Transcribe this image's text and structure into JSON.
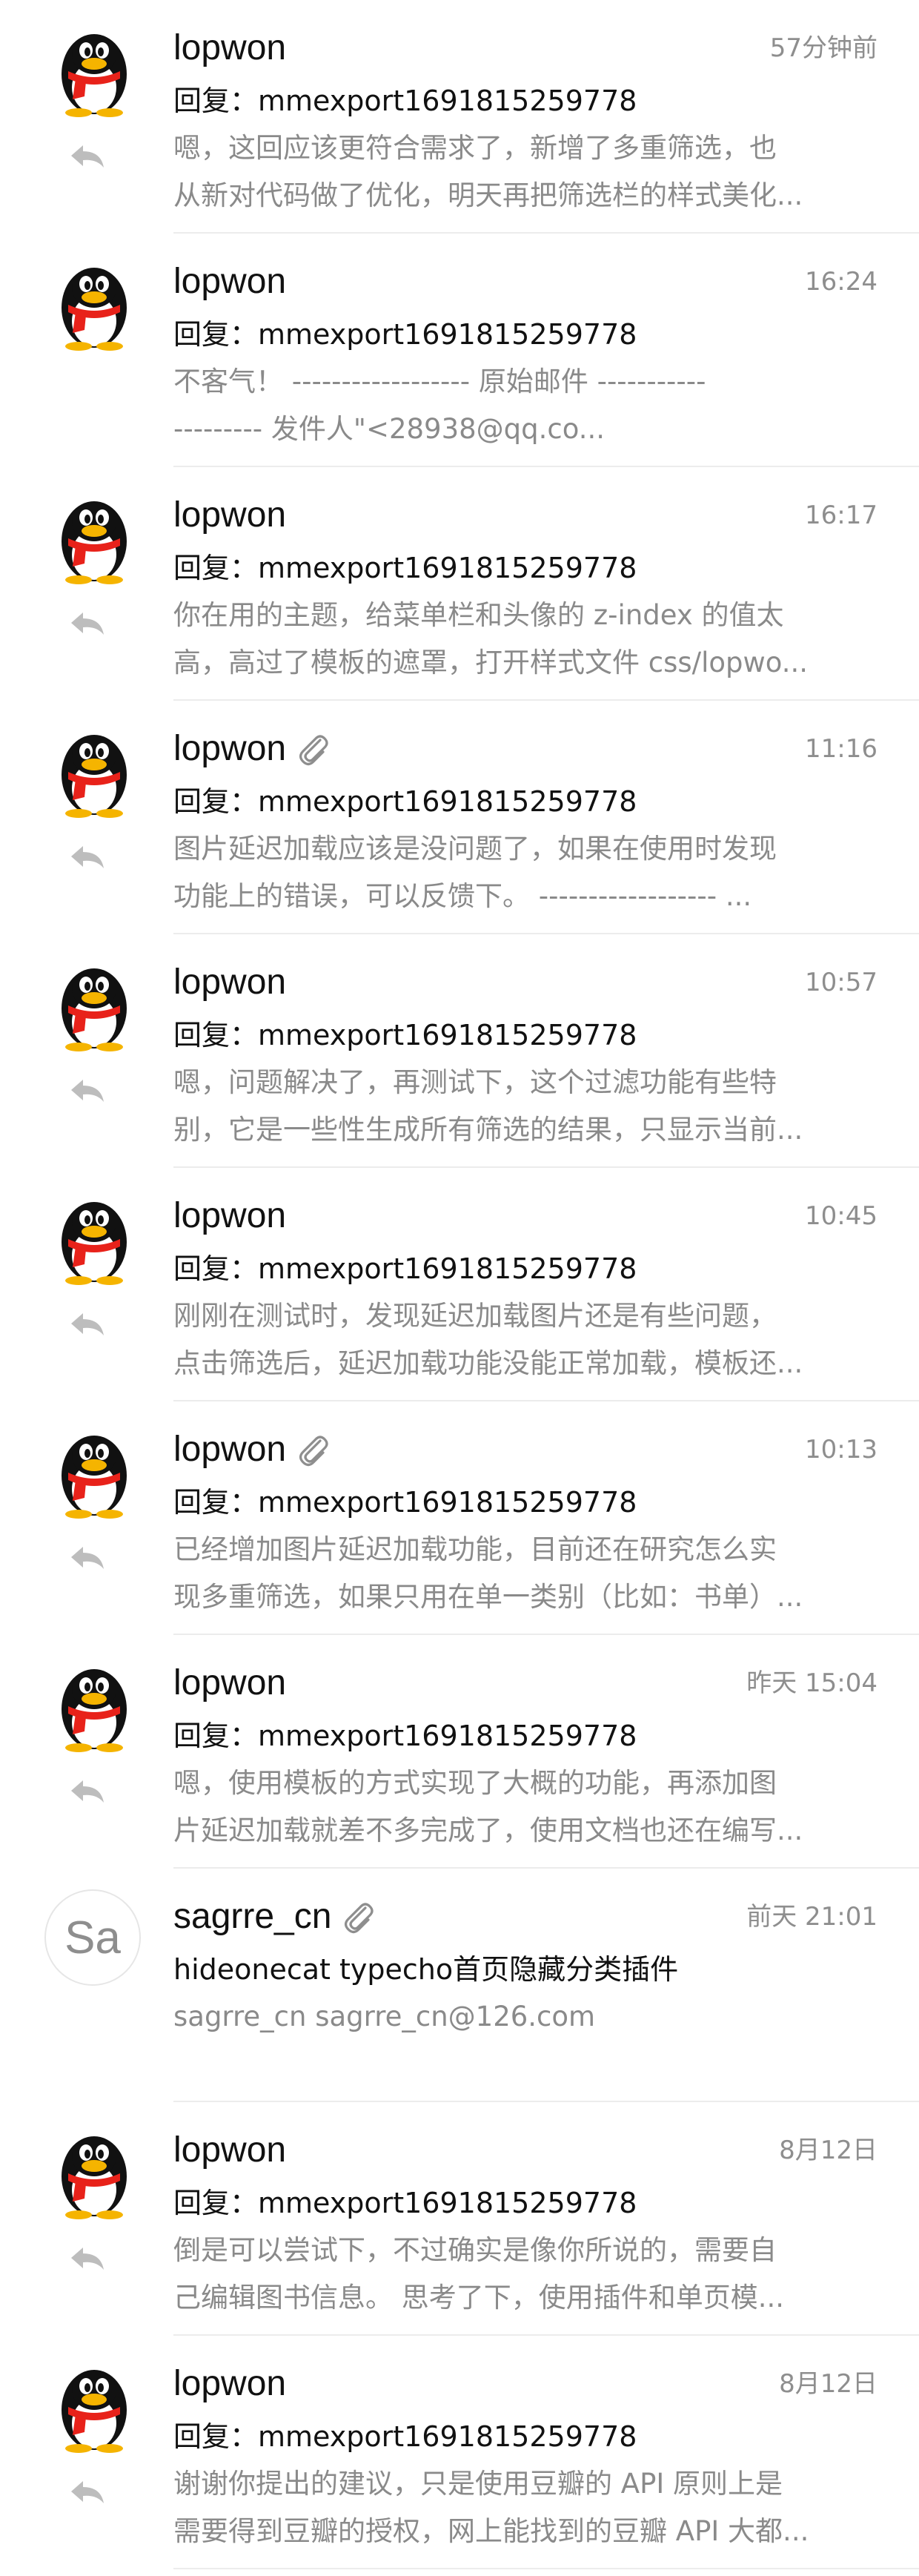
{
  "icons": {
    "avatar": "qq-penguin-avatar",
    "reply": "reply-arrow-icon",
    "attachment": "paperclip-icon"
  },
  "colors": {
    "primary_text": "#111111",
    "secondary_text": "#8a8a8a",
    "divider": "#ececec",
    "penguin_scarf": "#e8221a"
  },
  "emails": [
    {
      "sender": "lopwon",
      "time": "57分钟前",
      "subject": "回复：mmexport1691815259778",
      "preview": [
        "嗯，这回应该更符合需求了，新增了多重筛选，也",
        "从新对代码做了优化，明天再把筛选栏的样式美化..."
      ],
      "has_attachment": false,
      "replied": true
    },
    {
      "sender": "lopwon",
      "time": "16:24",
      "subject": "回复：mmexport1691815259778",
      "preview": [
        "不客气！    ------------------ 原始邮件 -----------",
        "--------- 发件人\"<28938@qq.co..."
      ],
      "has_attachment": false,
      "replied": false
    },
    {
      "sender": "lopwon",
      "time": "16:17",
      "subject": "回复：mmexport1691815259778",
      "preview": [
        "你在用的主题，给菜单栏和头像的 z-index 的值太",
        "高，高过了模板的遮罩，打开样式文件 css/lopwo..."
      ],
      "has_attachment": false,
      "replied": true
    },
    {
      "sender": "lopwon",
      "time": "11:16",
      "subject": "回复：mmexport1691815259778",
      "preview": [
        "图片延迟加载应该是没问题了，如果在使用时发现",
        "功能上的错误，可以反馈下。  ------------------ ..."
      ],
      "has_attachment": true,
      "replied": true
    },
    {
      "sender": "lopwon",
      "time": "10:57",
      "subject": "回复：mmexport1691815259778",
      "preview": [
        "嗯，问题解决了，再测试下，这个过滤功能有些特",
        "别，它是一些性生成所有筛选的结果，只显示当前..."
      ],
      "has_attachment": false,
      "replied": true
    },
    {
      "sender": "lopwon",
      "time": "10:45",
      "subject": "回复：mmexport1691815259778",
      "preview": [
        "刚刚在测试时，发现延迟加载图片还是有些问题，",
        "点击筛选后，延迟加载功能没能正常加载，模板还..."
      ],
      "has_attachment": false,
      "replied": true
    },
    {
      "sender": "lopwon",
      "time": "10:13",
      "subject": "回复：mmexport1691815259778",
      "preview": [
        "已经增加图片延迟加载功能，目前还在研究怎么实",
        "现多重筛选，如果只用在单一类别（比如：书单）..."
      ],
      "has_attachment": true,
      "replied": true
    },
    {
      "sender": "lopwon",
      "time": "昨天 15:04",
      "subject": "回复：mmexport1691815259778",
      "preview": [
        "嗯，使用模板的方式实现了大概的功能，再添加图",
        "片延迟加载就差不多完成了，使用文档也还在编写..."
      ],
      "has_attachment": false,
      "replied": true
    },
    {
      "sender": "sagrre_cn",
      "avatar_text": "Sa",
      "time": "前天 21:01",
      "subject": "hideonecat typecho首页隐藏分类插件",
      "preview": [
        "sagrre_cn  sagrre_cn@126.com"
      ],
      "has_attachment": true,
      "replied": false
    },
    {
      "sender": "lopwon",
      "time": "8月12日",
      "subject": "回复：mmexport1691815259778",
      "preview": [
        "倒是可以尝试下，不过确实是像你所说的，需要自",
        "己编辑图书信息。 思考了下，使用插件和单页模..."
      ],
      "has_attachment": false,
      "replied": true
    },
    {
      "sender": "lopwon",
      "time": "8月12日",
      "subject": "回复：mmexport1691815259778",
      "preview": [
        "谢谢你提出的建议，只是使用豆瓣的 API 原则上是",
        "需要得到豆瓣的授权，网上能找到的豆瓣 API 大都..."
      ],
      "has_attachment": false,
      "replied": true
    }
  ]
}
